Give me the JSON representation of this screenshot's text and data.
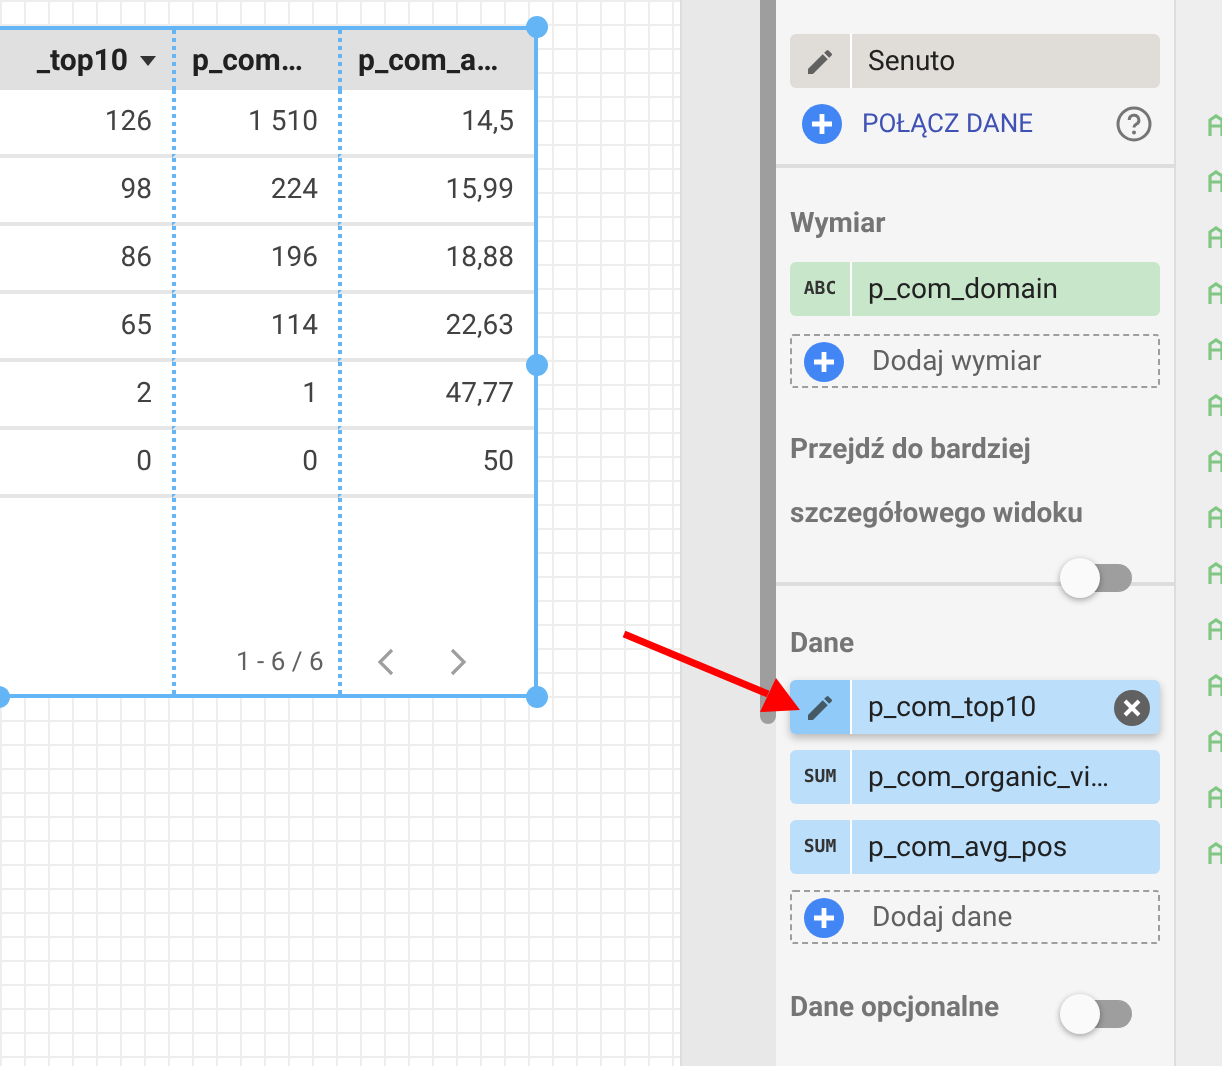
{
  "table": {
    "selected": true,
    "columns": [
      {
        "label": "_top10",
        "sorted": true
      },
      {
        "label": "p_com…",
        "sorted": false
      },
      {
        "label": "p_com_a…",
        "sorted": false
      }
    ],
    "rows": [
      [
        "126",
        "1 510",
        "14,5"
      ],
      [
        "98",
        "224",
        "15,99"
      ],
      [
        "86",
        "196",
        "18,88"
      ],
      [
        "65",
        "114",
        "22,63"
      ],
      [
        "2",
        "1",
        "47,77"
      ],
      [
        "0",
        "0",
        "50"
      ]
    ],
    "pagination": "1 - 6 / 6"
  },
  "panel": {
    "source": {
      "name": "Senuto",
      "connect": "POŁĄCZ DANE"
    },
    "dimension": {
      "heading": "Wymiar",
      "fields": [
        {
          "kind": "typed",
          "badge": "ABC",
          "label": "p_com_domain"
        }
      ],
      "add": "Dodaj wymiar"
    },
    "drill_down": {
      "label": "Przejdź do bardziej szczegółowego widoku",
      "on": false
    },
    "metrics": {
      "heading": "Dane",
      "fields": [
        {
          "kind": "editing",
          "label": "p_com_top10"
        },
        {
          "kind": "typed",
          "badge": "SUM",
          "label": "p_com_organic_vi…"
        },
        {
          "kind": "typed",
          "badge": "SUM",
          "label": "p_com_avg_pos"
        }
      ],
      "add": "Dodaj dane"
    },
    "optional": {
      "label": "Dane opcjonalne",
      "on": false
    }
  }
}
